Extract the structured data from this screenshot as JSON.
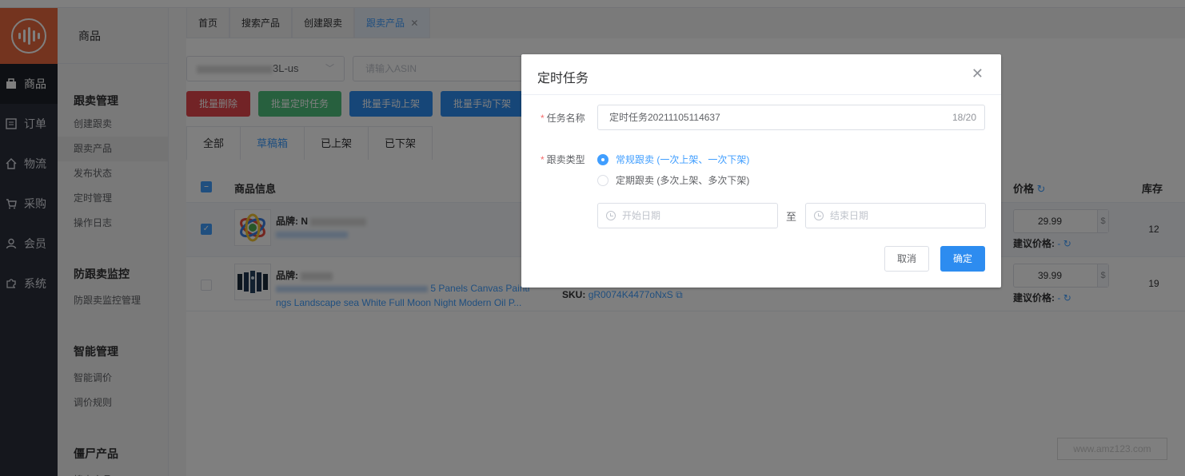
{
  "rail": {
    "items": [
      {
        "label": "商品",
        "icon": "bag-icon"
      },
      {
        "label": "订单",
        "icon": "list-icon"
      },
      {
        "label": "物流",
        "icon": "home-icon"
      },
      {
        "label": "采购",
        "icon": "cart-icon"
      },
      {
        "label": "会员",
        "icon": "user-icon"
      },
      {
        "label": "系统",
        "icon": "puzzle-icon"
      }
    ]
  },
  "submenu": {
    "title": "商品",
    "groups": [
      {
        "title": "跟卖管理",
        "links": [
          "创建跟卖",
          "跟卖产品",
          "发布状态",
          "定时管理",
          "操作日志"
        ]
      },
      {
        "title": "防跟卖监控",
        "links": [
          "防跟卖监控管理"
        ]
      },
      {
        "title": "智能管理",
        "links": [
          "智能调价",
          "调价规则"
        ]
      },
      {
        "title": "僵尸产品",
        "links": [
          "搜索产品"
        ]
      }
    ]
  },
  "tabs": [
    "首页",
    "搜索产品",
    "创建跟卖",
    "跟卖产品"
  ],
  "toolbar": {
    "store_suffix": "3L-us",
    "asin_placeholder": "请输入ASIN",
    "buttons": [
      "批量删除",
      "批量定时任务",
      "批量手动上架",
      "批量手动下架"
    ]
  },
  "status_tabs": [
    "全部",
    "草稿箱",
    "已上架",
    "已下架"
  ],
  "table": {
    "headers": {
      "product": "商品信息",
      "price": "价格",
      "stock": "库存"
    },
    "rows": [
      {
        "brand_label": "品牌: N",
        "title": "",
        "sku_label": "",
        "sku": "",
        "price": "29.99",
        "currency": "$",
        "suggest_label": "建议价格:",
        "suggest_value": "-",
        "stock": "12",
        "checked": true
      },
      {
        "brand_label": "品牌:",
        "title_line1": "5 Panels Canvas Painti",
        "title_line2": "ngs Landscape sea White Full Moon Night Modern Oil P...",
        "sku_label": "SKU:",
        "sku": "gR0074K4477oNxS",
        "price": "39.99",
        "currency": "$",
        "suggest_label": "建议价格:",
        "suggest_value": "-",
        "stock": "19",
        "checked": false
      }
    ]
  },
  "dialog": {
    "title": "定时任务",
    "name_label": "任务名称",
    "name_value": "定时任务20211105114637",
    "name_count": "18/20",
    "type_label": "跟卖类型",
    "option_regular": "常规跟卖 (一次上架、一次下架)",
    "option_periodic": "定期跟卖 (多次上架、多次下架)",
    "start_placeholder": "开始日期",
    "to_label": "至",
    "end_placeholder": "结束日期",
    "cancel": "取消",
    "confirm": "确定"
  },
  "watermark": "www.amz123.com",
  "colors": {
    "brand": "#e8693e",
    "primary": "#2d8cf0",
    "danger": "#e5474d",
    "success": "#4fc17d"
  }
}
